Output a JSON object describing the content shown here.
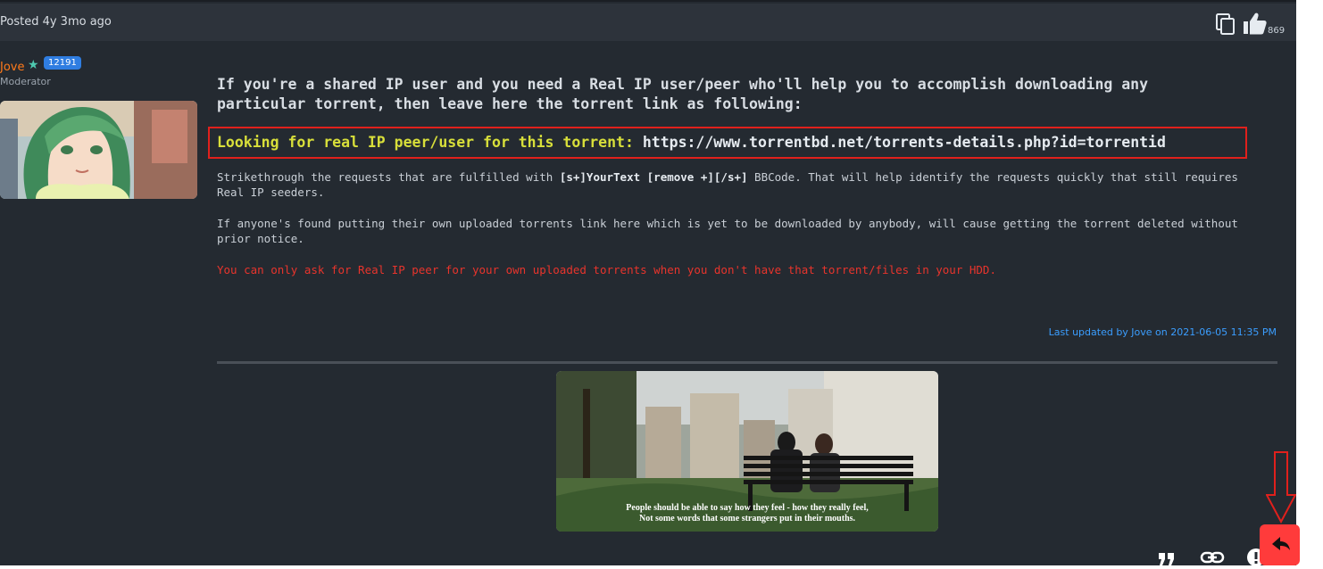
{
  "header": {
    "posted": "Posted 4y 3mo ago",
    "like_count": "869",
    "icons": {
      "copy": "copy-icon",
      "like": "thumbs-up-icon"
    }
  },
  "author": {
    "name": "Jove",
    "reputation": "12191",
    "role": "Moderator",
    "icons": {
      "star": "star-icon",
      "avatar": "avatar-image"
    }
  },
  "post": {
    "intro": "If you're a shared IP user and you need a Real IP user/peer who'll help you to accomplish downloading any particular torrent, then leave here the torrent link as following:",
    "highlight_label": "Looking for real IP peer/user for this torrent:",
    "highlight_link": "https://www.torrentbd.net/torrents-details.php?id=torrentid",
    "p1_a": "Strikethrough the requests that are fulfilled with ",
    "p1_code": "[s+]YourText [remove +][/s+]",
    "p1_b": " BBCode. That will help identify the requests quickly that still requires Real IP seeders.",
    "p2": "If anyone's found putting their own uploaded torrents link here which is yet to be downloaded by anybody, will cause getting the torrent deleted without prior notice.",
    "p3": "You can only ask for Real IP peer for your own uploaded torrents when you don't have that torrent/files in your HDD.",
    "last_updated": "Last updated by Jove on 2021-06-05 11:35 PM",
    "image_caption_1": "People should be able to say how they feel - how they really feel,",
    "image_caption_2": "Not some words that some strangers put in their mouths."
  },
  "footer": {
    "icons": {
      "quote": "quote-icon",
      "link": "link-icon",
      "report": "report-icon",
      "reply": "reply-icon"
    }
  },
  "colors": {
    "background": "#242a31",
    "header": "#2d333b",
    "highlight_border": "#e0201c",
    "highlight_label": "#d8df3a",
    "warning": "#e8342c",
    "accent": "#3b9eff",
    "author": "#ff7a1a",
    "reply_button": "#ff3b3b"
  }
}
